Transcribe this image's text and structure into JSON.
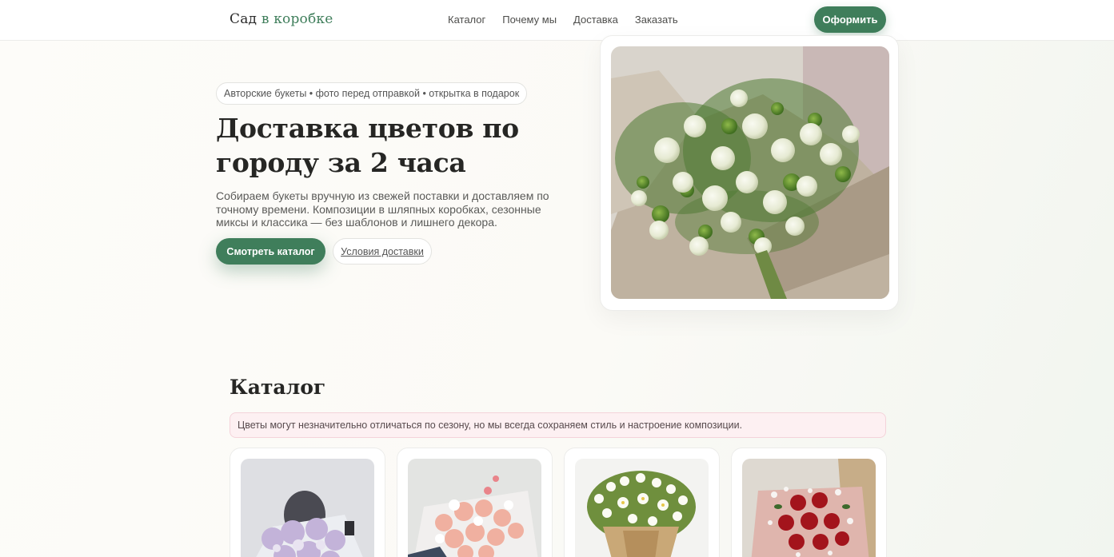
{
  "header": {
    "logo_main": "Сад ",
    "logo_accent": "в коробке",
    "nav": [
      "Каталог",
      "Почему мы",
      "Доставка",
      "Заказать"
    ],
    "cta": "Оформить"
  },
  "hero": {
    "badge": "Авторские букеты • фото перед отправкой • открытка в подарок",
    "title": "Доставка цветов по городу за 2 часа",
    "description": "Собираем букеты вручную из свежей поставки и доставляем по точному времени. Композиции в шляпных коробках, сезонные миксы и классика — без шаблонов и лишнего декора.",
    "primary_button": "Смотреть каталог",
    "secondary_button": "Условия доставки"
  },
  "catalog": {
    "title": "Каталог",
    "notice": "Цветы могут незначительно отличаться по сезону, но мы всегда сохраняем стиль и настроение композиции."
  },
  "colors": {
    "accent": "#3f7e5b",
    "notice_bg": "#fdf0f2"
  }
}
